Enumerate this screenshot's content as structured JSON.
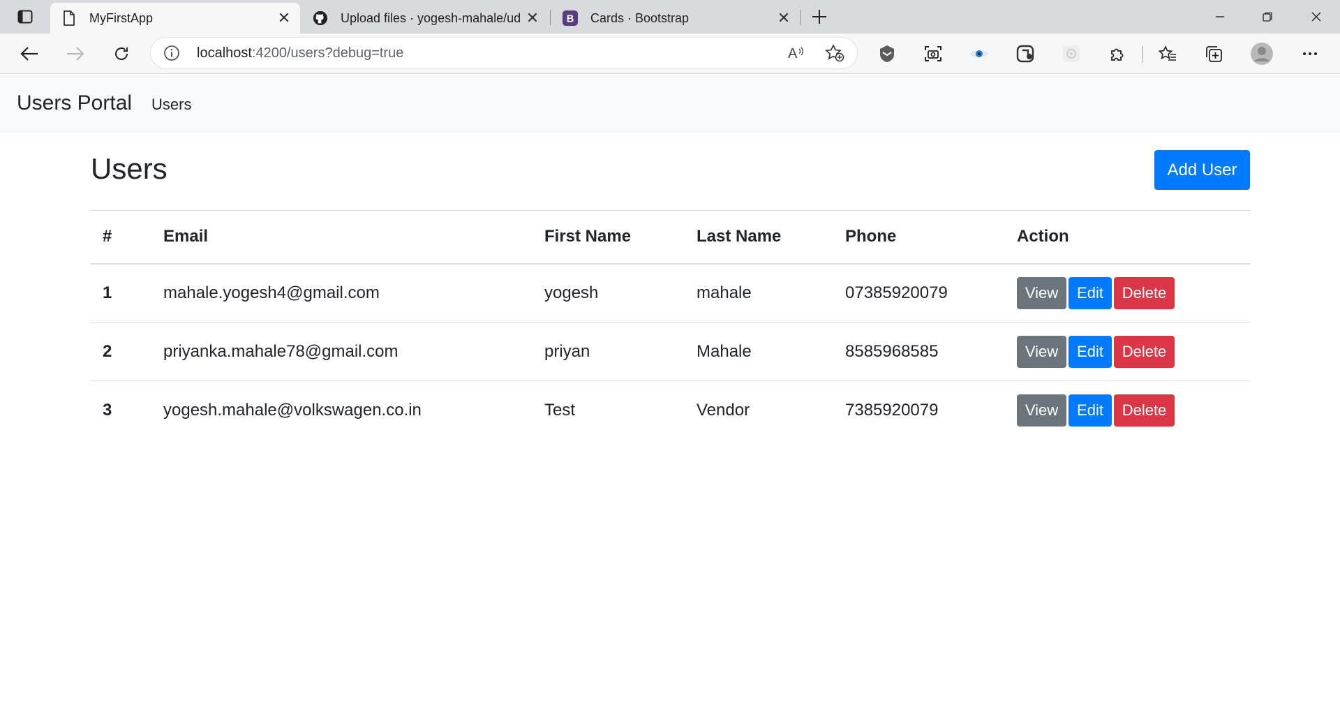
{
  "browser": {
    "tabs": [
      {
        "title": "MyFirstApp",
        "icon": "page-icon",
        "active": true
      },
      {
        "title": "Upload files · yogesh-mahale/ud",
        "icon": "github-icon",
        "active": false
      },
      {
        "title": "Cards · Bootstrap",
        "icon": "bootstrap-icon",
        "active": false
      }
    ],
    "url_host": "localhost",
    "url_rest": ":4200/users?debug=true"
  },
  "app": {
    "brand": "Users Portal",
    "nav_link": "Users"
  },
  "page": {
    "title": "Users",
    "add_button": "Add User"
  },
  "table": {
    "headers": [
      "#",
      "Email",
      "First Name",
      "Last Name",
      "Phone",
      "Action"
    ],
    "rows": [
      {
        "num": "1",
        "email": "mahale.yogesh4@gmail.com",
        "first": "yogesh",
        "last": "mahale",
        "phone": "07385920079"
      },
      {
        "num": "2",
        "email": "priyanka.mahale78@gmail.com",
        "first": "priyan",
        "last": "Mahale",
        "phone": "8585968585"
      },
      {
        "num": "3",
        "email": "yogesh.mahale@volkswagen.co.in",
        "first": "Test",
        "last": "Vendor",
        "phone": "7385920079"
      }
    ],
    "actions": {
      "view": "View",
      "edit": "Edit",
      "delete": "Delete"
    }
  },
  "colors": {
    "primary": "#007bff",
    "secondary": "#6c757d",
    "danger": "#dc3545",
    "navbar_bg": "#f8f9fa"
  }
}
